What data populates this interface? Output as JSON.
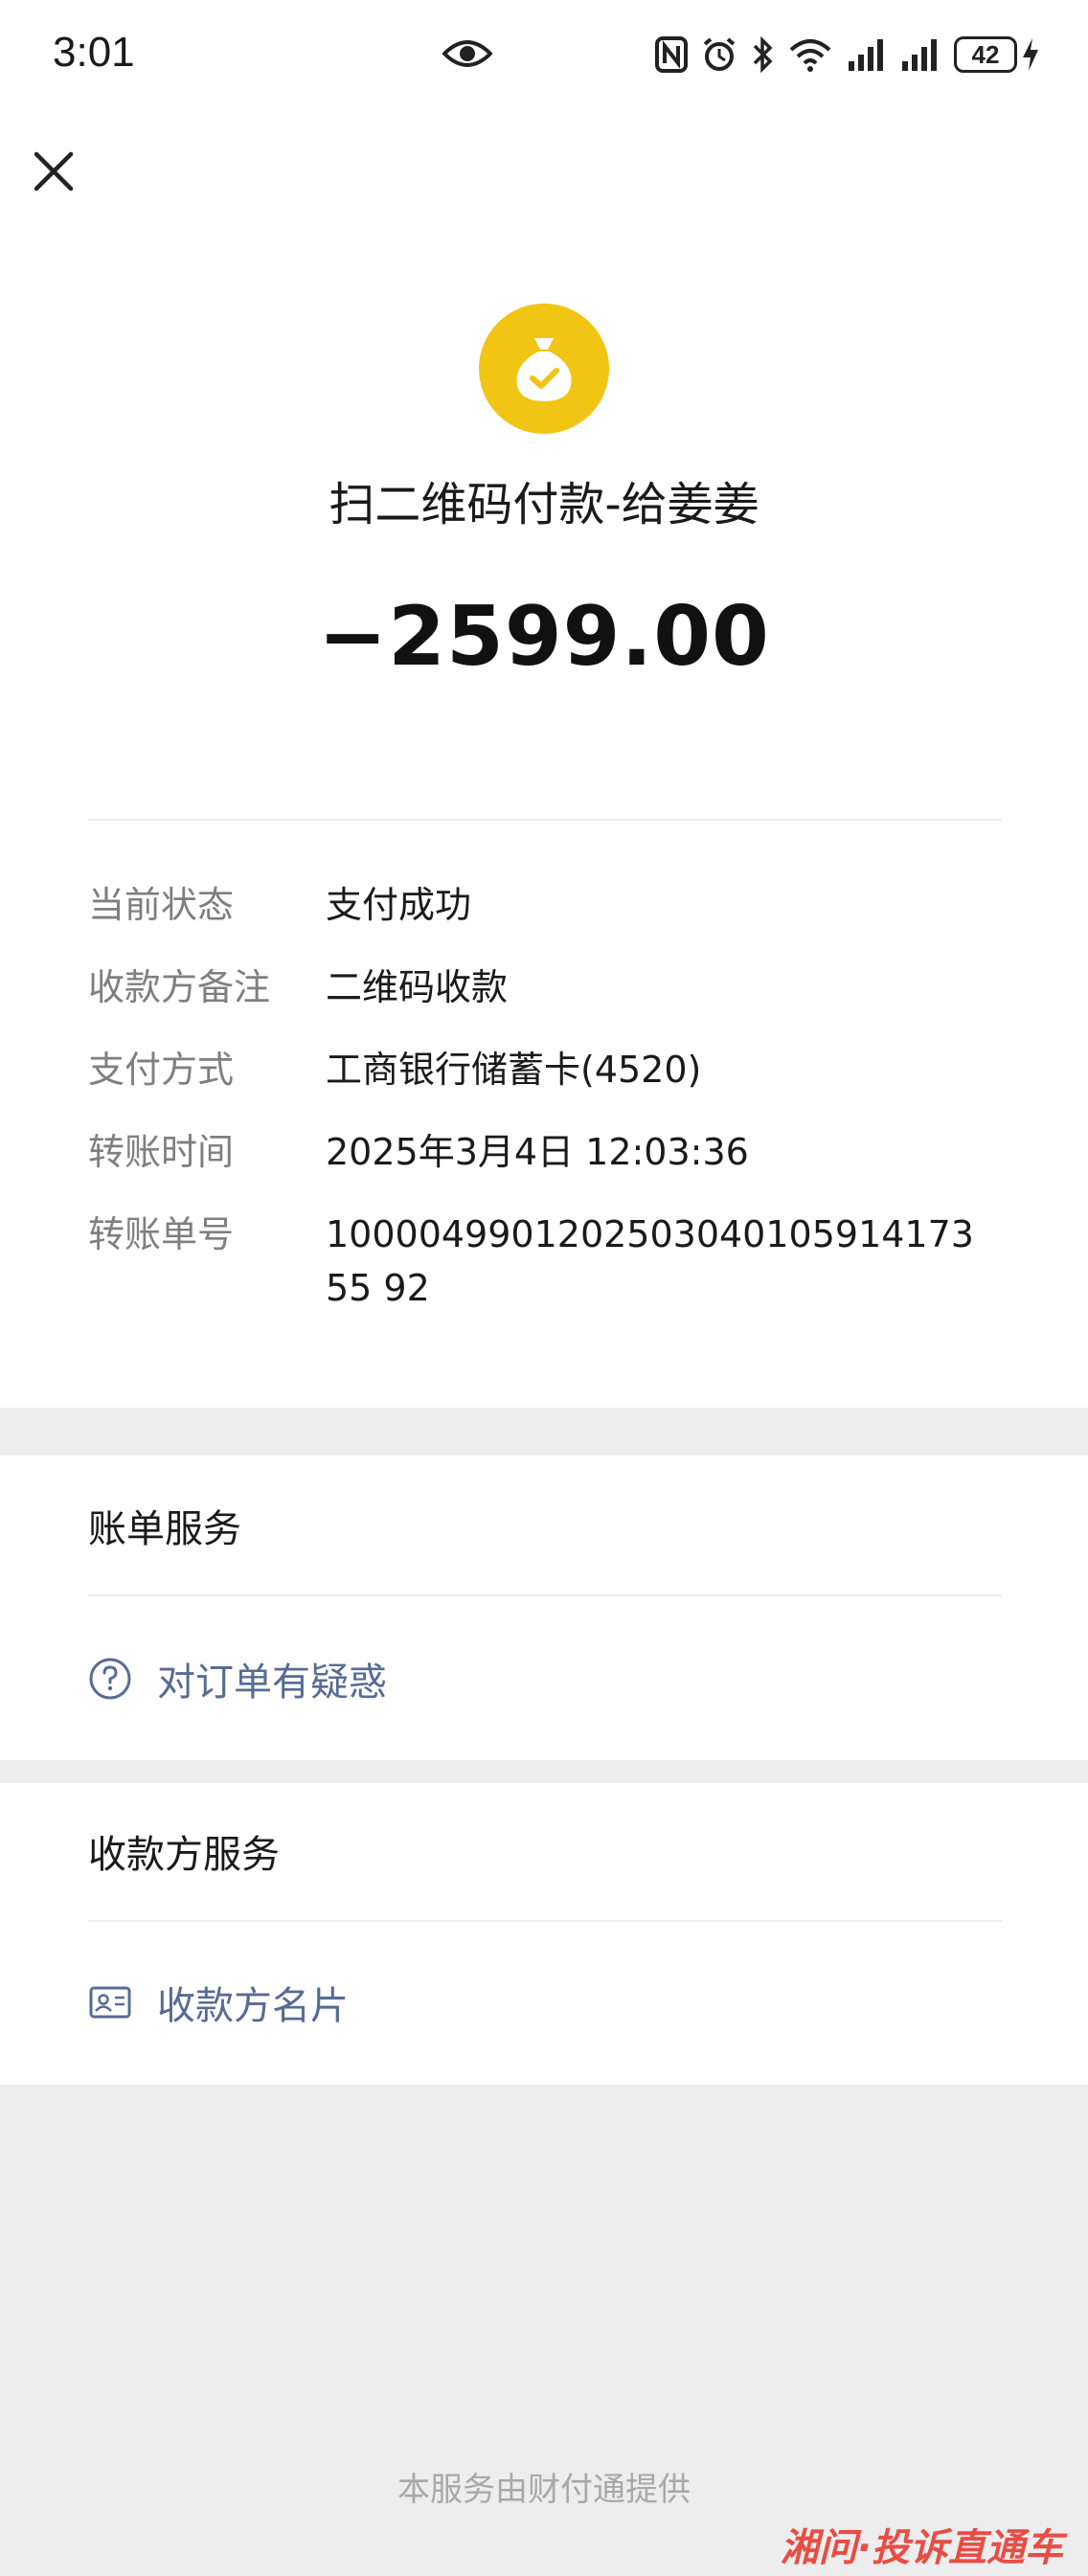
{
  "status_bar": {
    "time": "3:01",
    "battery": "42",
    "icons": [
      "eye-icon",
      "nfc-icon",
      "alarm-icon",
      "bluetooth-icon",
      "wifi-icon",
      "signal-icon",
      "signal-icon",
      "battery-icon",
      "charging-icon"
    ]
  },
  "nav": {
    "close_icon": "close-icon"
  },
  "payment": {
    "icon": "money-bag-check-icon",
    "icon_color": "#f2c413",
    "title": "扫二维码付款-给姜姜",
    "amount": "−2599.00"
  },
  "details": [
    {
      "label": "当前状态",
      "value": "支付成功"
    },
    {
      "label": "收款方备注",
      "value": "二维码收款"
    },
    {
      "label": "支付方式",
      "value": "工商银行储蓄卡(4520)"
    },
    {
      "label": "转账时间",
      "value": "2025年3月4日 12:03:36"
    },
    {
      "label": "转账单号",
      "value": "100004990120250304010591417355 92"
    }
  ],
  "bill_service": {
    "title": "账单服务",
    "link": "对订单有疑惑",
    "link_icon": "question-circle-icon"
  },
  "payee_service": {
    "title": "收款方服务",
    "link": "收款方名片",
    "link_icon": "contact-card-icon"
  },
  "footer": "本服务由财付通提供",
  "watermark": "湘问·投诉直通车",
  "colors": {
    "link": "#576b95",
    "label": "#7f7f7f",
    "background": "#ededed"
  }
}
